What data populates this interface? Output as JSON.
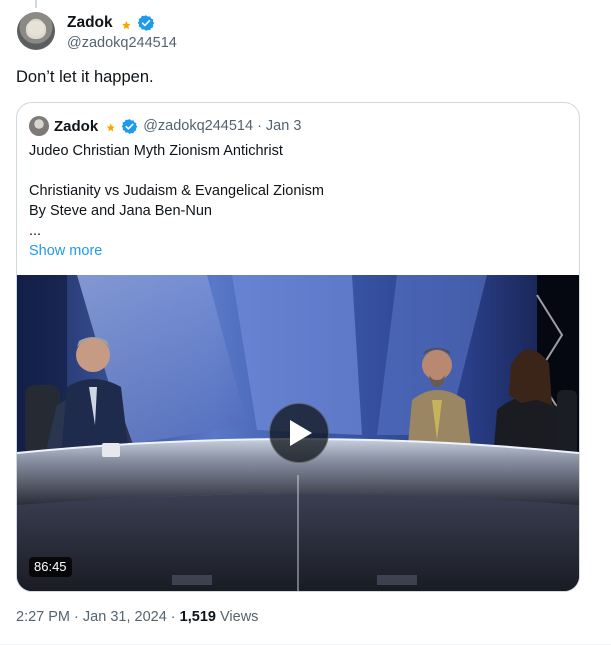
{
  "author": {
    "display_name": "Zadok",
    "handle": "@zadokq244514",
    "emoji": "dizzy-star",
    "verified": true
  },
  "tweet": {
    "text": "Don’t let it happen."
  },
  "quote": {
    "display_name": "Zadok",
    "handle": "@zadokq244514",
    "separator": "·",
    "date": "Jan 3",
    "lines": [
      "Judeo Christian Myth Zionism Antichrist",
      "",
      "Christianity vs Judaism & Evangelical Zionism",
      "By Steve and Jana Ben-Nun",
      "..."
    ],
    "show_more": "Show more",
    "video": {
      "duration": "86:45"
    }
  },
  "meta": {
    "time": "2:27 PM",
    "sep1": "·",
    "date": "Jan 31, 2024",
    "sep2": "·",
    "views_count": "1,519",
    "views_label": "Views"
  },
  "colors": {
    "accent": "#1d9bf0",
    "verified": "#1d9bf0",
    "secondary_text": "#536471",
    "border": "#cfd9de"
  }
}
